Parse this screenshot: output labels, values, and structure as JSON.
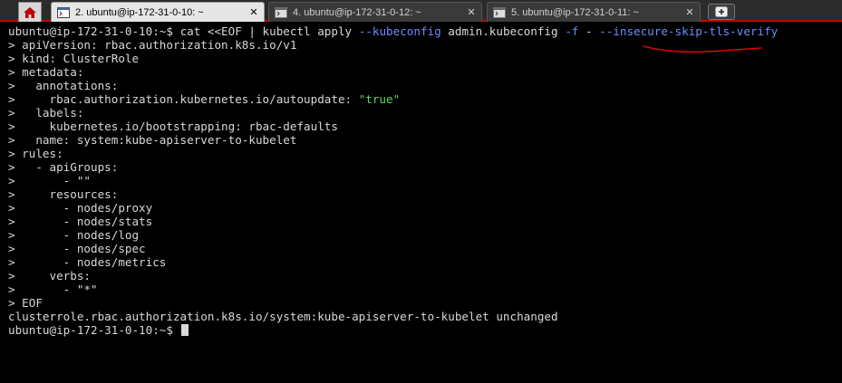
{
  "tabs": [
    {
      "label": "2. ubuntu@ip-172-31-0-10: ~",
      "active": true
    },
    {
      "label": "4. ubuntu@ip-172-31-0-12: ~",
      "active": false
    },
    {
      "label": "5. ubuntu@ip-172-31-0-11: ~",
      "active": false
    }
  ],
  "icons": {
    "home": "home-icon",
    "terminal": "terminal-icon",
    "close": "close-icon",
    "new_tab": "plus-icon"
  },
  "tab_close_glyph": "✕",
  "terminal": {
    "cmd": {
      "prompt": "ubuntu@ip-172-31-0-10:~$ ",
      "text": "cat <<EOF | kubectl apply ",
      "opt1": "--kubeconfig",
      "mid": " admin.kubeconfig ",
      "opt2": "-f",
      "mid2": " - ",
      "opt3": "--insecure-skip-tls-verify"
    },
    "lines": [
      "> apiVersion: rbac.authorization.k8s.io/v1",
      "> kind: ClusterRole",
      "> metadata:",
      ">   annotations:",
      ">     rbac.authorization.kubernetes.io/autoupdate: ",
      ">   labels:",
      ">     kubernetes.io/bootstrapping: rbac-defaults",
      ">   name: system:kube-apiserver-to-kubelet",
      "> rules:",
      ">   - apiGroups:",
      ">       - ",
      ">     resources:",
      ">       - nodes/proxy",
      ">       - nodes/stats",
      ">       - nodes/log",
      ">       - nodes/spec",
      ">       - nodes/metrics",
      ">     verbs:",
      ">       - ",
      "> EOF",
      "clusterrole.rbac.authorization.k8s.io/system:kube-apiserver-to-kubelet unchanged"
    ],
    "strings": {
      "autoupdate": "\"true\"",
      "api_group": "\"\"",
      "verb": "\"*\""
    },
    "final_prompt": "ubuntu@ip-172-31-0-10:~$ "
  },
  "colors": {
    "string": "#5fd75f",
    "option": "#6c8cff",
    "annotation": "#e00000",
    "tabbar_border": "#cc0000"
  }
}
